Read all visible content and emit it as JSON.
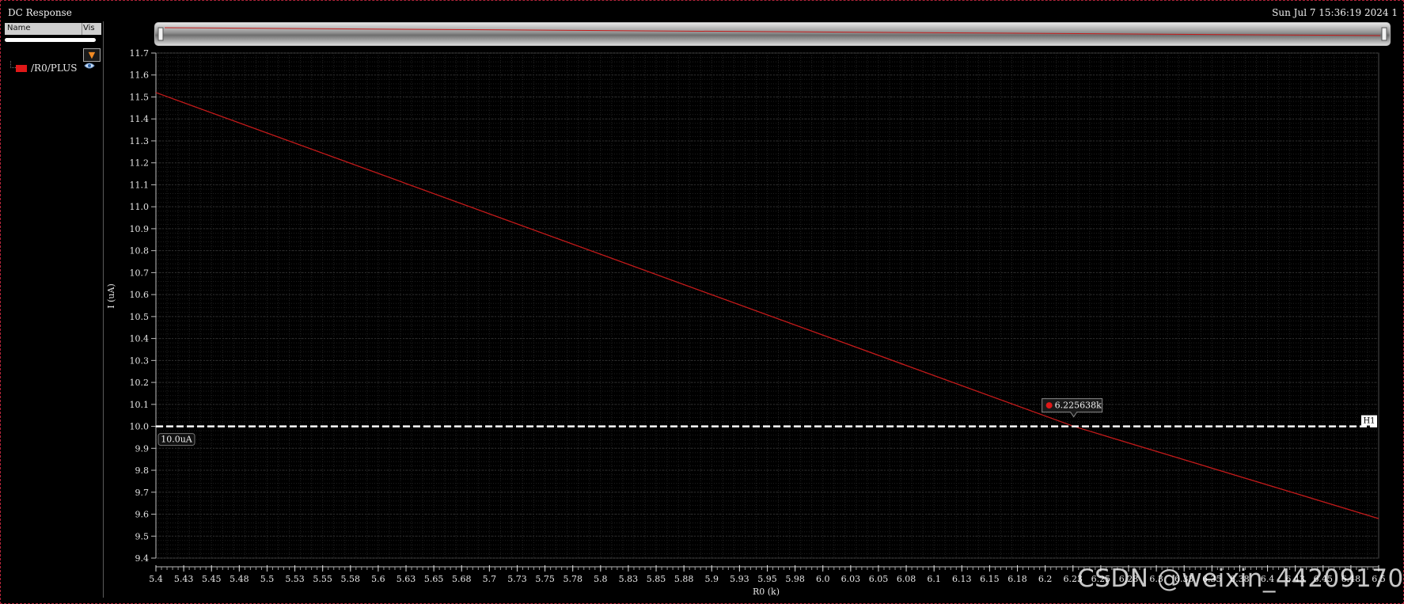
{
  "window": {
    "title": "DC Response",
    "timestamp": "Sun Jul 7 15:36:19 2024   1"
  },
  "sidebar": {
    "columns": {
      "name": "Name",
      "vis": "Vis"
    },
    "filter_icon": "filter-funnel-icon",
    "signals": [
      {
        "name": "/R0/PLUS",
        "color": "#e01818",
        "visibility_icon": "eye-icon"
      }
    ]
  },
  "watermark": "CSDN @weixin_44209170",
  "colors": {
    "background": "#000000",
    "trace": "#c41a1a",
    "marker": "#ffffff",
    "grid": "#2e2e2e",
    "frame": "#b3243a"
  },
  "chart_data": {
    "type": "line",
    "title": "",
    "xlabel": "R0 (k)",
    "ylabel": "I (uA)",
    "xlim": [
      5.4,
      6.5
    ],
    "ylim": [
      9.4,
      11.7
    ],
    "x_ticks": [
      "5.4",
      "5.43",
      "5.45",
      "5.48",
      "5.5",
      "5.53",
      "5.55",
      "5.58",
      "5.6",
      "5.63",
      "5.65",
      "5.68",
      "5.7",
      "5.73",
      "5.75",
      "5.78",
      "5.8",
      "5.83",
      "5.85",
      "5.88",
      "5.9",
      "5.93",
      "5.95",
      "5.98",
      "6.0",
      "6.03",
      "6.05",
      "6.08",
      "6.1",
      "6.13",
      "6.15",
      "6.18",
      "6.2",
      "6.23",
      "6.25",
      "6.28",
      "6.3",
      "6.33",
      "6.35",
      "6.38",
      "6.4",
      "6.43",
      "6.45",
      "6.48",
      "6.5"
    ],
    "y_ticks": [
      "9.4",
      "9.5",
      "9.6",
      "9.7",
      "9.8",
      "9.9",
      "10.0",
      "10.1",
      "10.2",
      "10.3",
      "10.4",
      "10.5",
      "10.6",
      "10.7",
      "10.8",
      "10.9",
      "11.0",
      "11.1",
      "11.2",
      "11.3",
      "11.4",
      "11.5",
      "11.6",
      "11.7"
    ],
    "grid": true,
    "series": [
      {
        "name": "/R0/PLUS",
        "x": [
          5.4,
          6.225638,
          6.5
        ],
        "y": [
          11.52,
          10.0,
          9.58
        ]
      }
    ],
    "markers": [
      {
        "type": "horizontal",
        "name": "H1",
        "value": 10.0,
        "label": "10.0uA"
      },
      {
        "type": "intercept",
        "x": 6.225638,
        "y": 10.0,
        "label": "6.225638k"
      }
    ]
  }
}
